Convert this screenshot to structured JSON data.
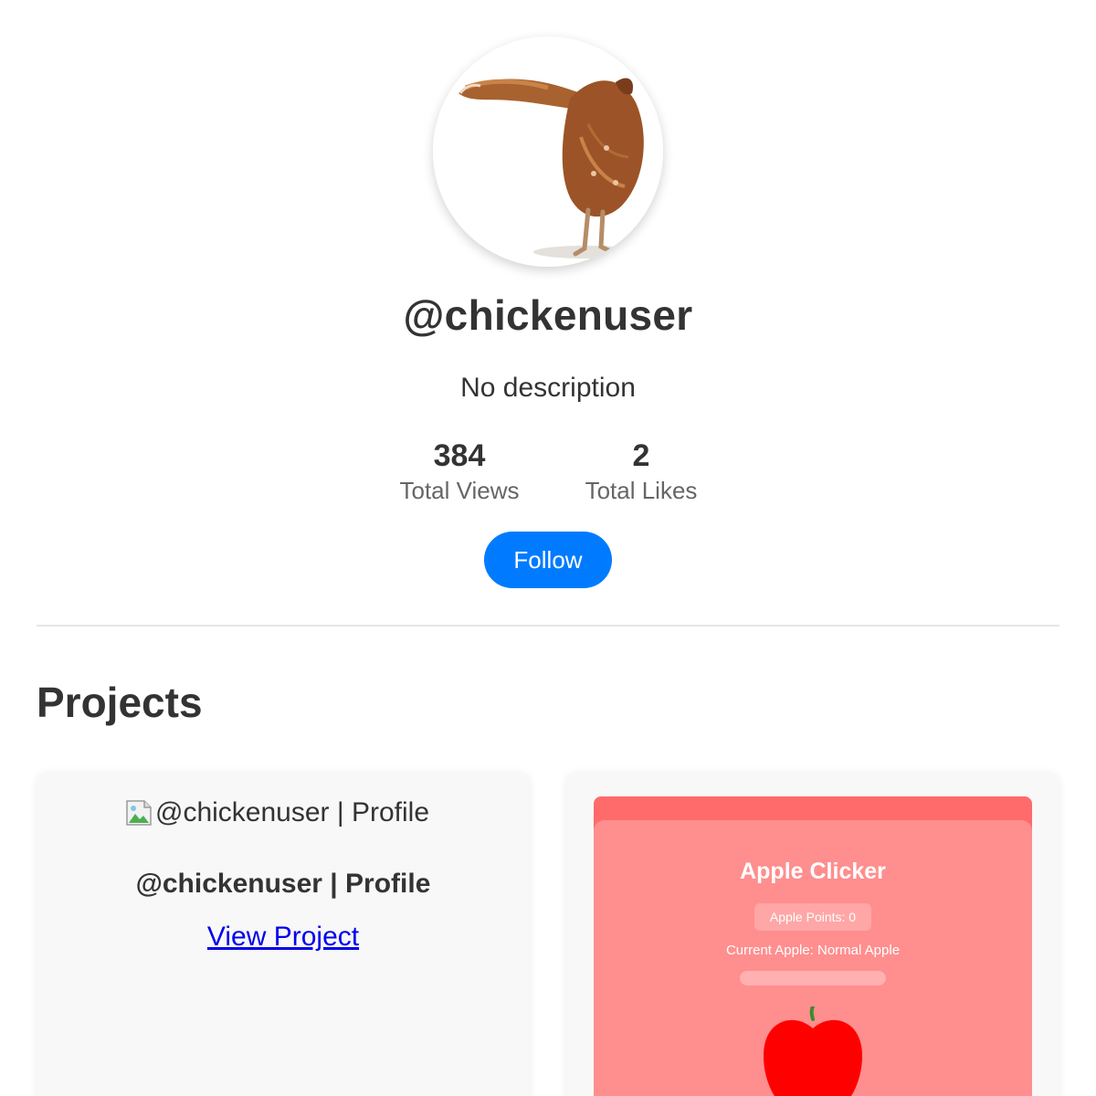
{
  "profile": {
    "username": "@chickenuser",
    "description": "No description",
    "avatar_icon": "chicken-photo",
    "stats": {
      "views_value": "384",
      "views_label": "Total Views",
      "likes_value": "2",
      "likes_label": "Total Likes"
    },
    "follow_label": "Follow"
  },
  "projects": {
    "title": "Projects",
    "items": [
      {
        "image_alt": "@chickenuser | Profile",
        "title": "@chickenuser | Profile",
        "link_label": "View Project"
      },
      {
        "preview": {
          "title": "Apple Clicker",
          "points": "Apple Points: 0",
          "current_apple": "Current Apple: Normal Apple",
          "progress": 0
        }
      }
    ]
  },
  "colors": {
    "accent": "#007bff",
    "text": "#333333",
    "muted": "#666666",
    "link": "#0000ee",
    "preview_bg": "#ff6b6b",
    "preview_panel": "#ff8e8e",
    "apple": "#ff0000"
  }
}
